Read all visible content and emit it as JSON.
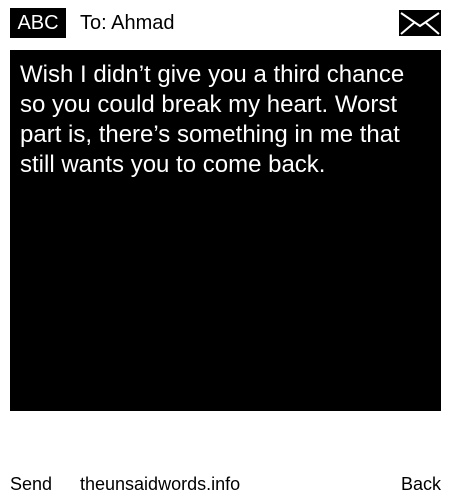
{
  "header": {
    "mode_label": "ABC",
    "recipient_text": "To: Ahmad",
    "icon": "envelope-icon"
  },
  "message": {
    "text": "Wish I didn’t give you a third chance so you could break my heart. Worst part is, there’s something in me that still wants you to come back."
  },
  "footer": {
    "send_label": "Send",
    "site_label": "theunsaidwords.info",
    "back_label": "Back"
  },
  "colors": {
    "background": "#ffffff",
    "message_background": "#000000",
    "message_text": "#ffffff"
  }
}
